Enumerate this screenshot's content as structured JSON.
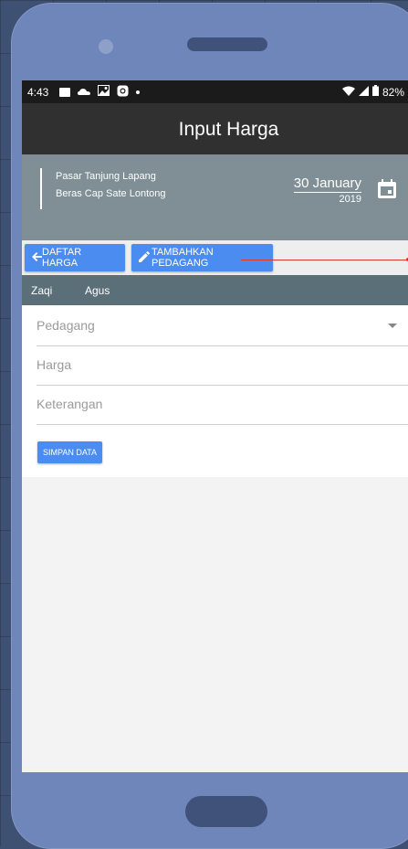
{
  "status_bar": {
    "time": "4:43",
    "battery": "82%",
    "icons": [
      "image-icon",
      "cloud-icon",
      "photo-icon",
      "instagram-icon",
      "dot-icon",
      "wifi-icon",
      "signal-icon",
      "battery-icon"
    ]
  },
  "app_bar": {
    "title": "Input Harga"
  },
  "header": {
    "market": "Pasar Tanjung Lapang",
    "product": "Beras Cap Sate Lontong",
    "date_day_month": "30 January",
    "date_year": "2019"
  },
  "actions": {
    "back_label": "DAFTAR HARGA",
    "add_label": "TAMBAHKAN PEDAGANG"
  },
  "tabs": [
    {
      "label": "Zaqi"
    },
    {
      "label": "Agus"
    }
  ],
  "form": {
    "pedagang_placeholder": "Pedagang",
    "harga_placeholder": "Harga",
    "keterangan_placeholder": "Keterangan",
    "save_label": "SIMPAN DATA"
  },
  "colors": {
    "background": "#3f5173",
    "phone_body": "#6f86ba",
    "app_bar": "#303030",
    "header": "#7f8f95",
    "tab_bar": "#5b6f79",
    "accent": "#4b8cf0",
    "annotation_line": "#e0362c"
  }
}
